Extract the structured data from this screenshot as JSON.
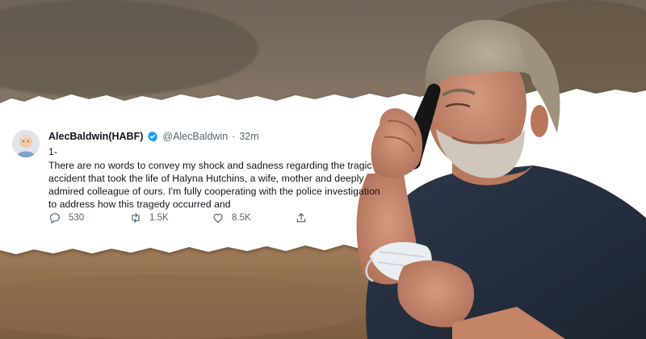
{
  "tweet": {
    "display_name": "AlecBaldwin(HABF)",
    "handle": "@AlecBaldwin",
    "separator": "·",
    "time": "32m",
    "lines": [
      "1-",
      "There are no words to convey my shock and sadness regarding the tragic",
      "accident that took the life of Halyna Hutchins, a wife, mother and deeply",
      "admired colleague of ours. I'm fully cooperating with the police investigation",
      "to address how this tragedy occurred and"
    ],
    "actions": {
      "reply_count": "530",
      "retweet_count": "1.5K",
      "like_count": "8.5K"
    }
  },
  "icons": {
    "verified": "verified-badge-icon",
    "reply": "reply-icon",
    "retweet": "retweet-icon",
    "like": "heart-icon",
    "share": "share-icon"
  },
  "colors": {
    "verified_blue": "#1d9bf0",
    "text_primary": "#0f1419",
    "text_secondary": "#536471"
  }
}
